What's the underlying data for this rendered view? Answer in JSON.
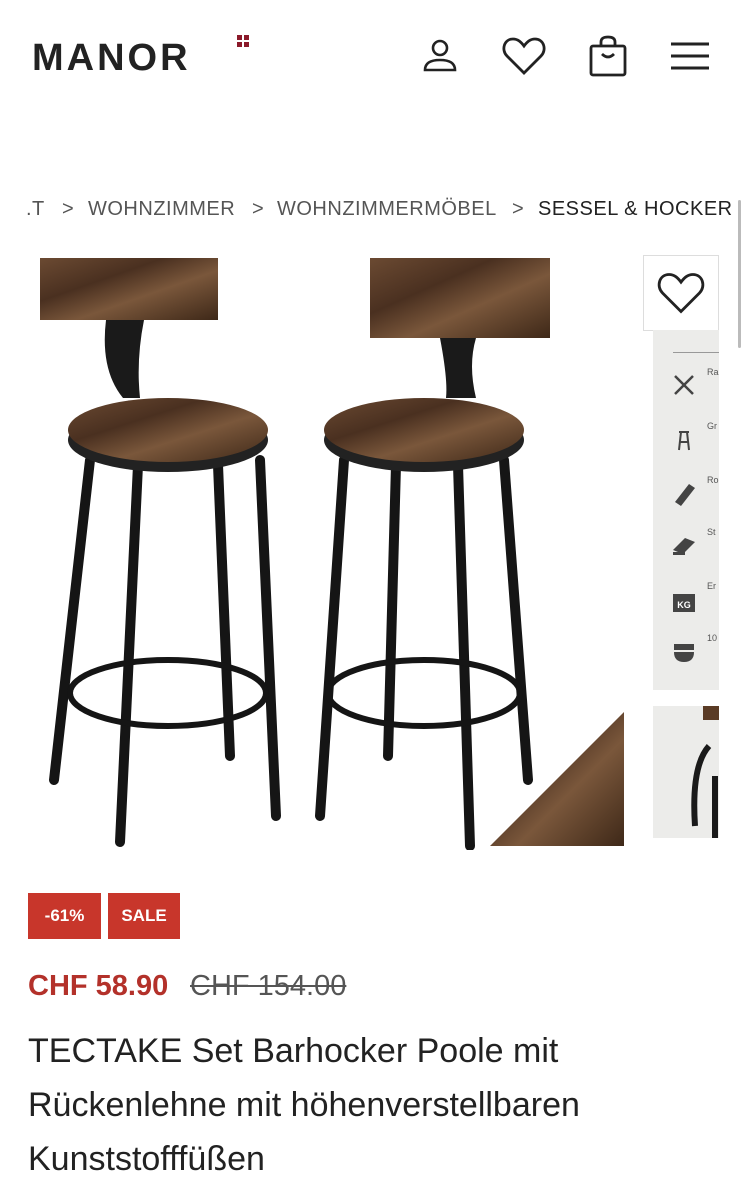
{
  "header": {
    "logo_text": "MANOR",
    "brand_color": "#8b1a2a",
    "icons": [
      "user-icon",
      "heart-icon",
      "shopping-bag-icon",
      "menu-icon"
    ]
  },
  "breadcrumb": {
    "items": [
      ".T",
      "WOHNZIMMER",
      "WOHNZIMMERMÖBEL",
      "SESSEL & HOCKER"
    ],
    "separator": ">"
  },
  "gallery": {
    "wishlist_icon": "heart-icon",
    "thumb_features": [
      "Ra",
      "Gr",
      "Ro",
      "St",
      "Er",
      "10"
    ],
    "kg_label": "KG"
  },
  "badges": {
    "discount": "-61%",
    "sale": "SALE",
    "color": "#c8362b"
  },
  "pricing": {
    "price": "CHF 58.90",
    "old_price": "CHF 154.00",
    "price_color": "#b3312a"
  },
  "product": {
    "title": "TECTAKE Set Barhocker Poole mit Rückenlehne mit höhenverstellbaren Kunststofffüßen"
  }
}
